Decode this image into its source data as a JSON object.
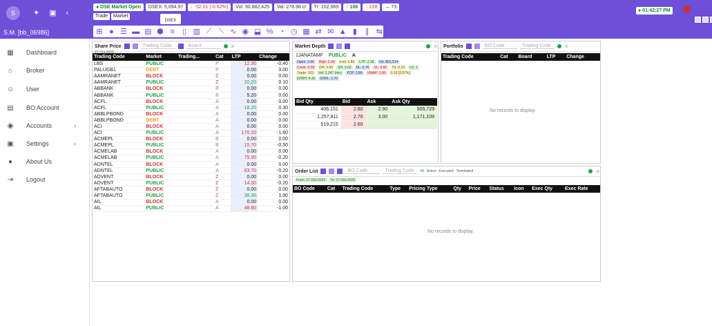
{
  "sidebar": {
    "avatar_letter": "S",
    "user_name": "S.M. [bb_06986]",
    "items": [
      {
        "label": "Dashboard",
        "icon": "dashboard-icon",
        "glyph": "▦",
        "arrow": ""
      },
      {
        "label": "Broker",
        "icon": "home-icon",
        "glyph": "⌂",
        "arrow": ""
      },
      {
        "label": "User",
        "icon": "user-icon",
        "glyph": "☺",
        "arrow": ""
      },
      {
        "label": "BO Account",
        "icon": "account-icon",
        "glyph": "▤",
        "arrow": ""
      },
      {
        "label": "Accounts",
        "icon": "accounts-icon",
        "glyph": "◉",
        "arrow": "›"
      },
      {
        "label": "Settings",
        "icon": "settings-icon",
        "glyph": "▣",
        "arrow": "›"
      },
      {
        "label": "About Us",
        "icon": "info-icon",
        "glyph": "●",
        "arrow": ""
      },
      {
        "label": "Logout",
        "icon": "logout-icon",
        "glyph": "⇥",
        "arrow": ""
      }
    ]
  },
  "ticker": {
    "market_status": "● DSE Market Open",
    "dsex": "DSEX: 5,094.97",
    "change": "↓ -32.01 (-0.62%)",
    "vol": "Vol: 90,882,425",
    "val": "Val: 278.98 cr",
    "trades": "Tr: 102,969",
    "up": "↑ 106",
    "down": "↓ 228",
    "unchanged": "↔ 73",
    "clock": "● 01:42:27 PM"
  },
  "tabs": {
    "trade": "Trade",
    "market": "Market",
    "dsex_label": "DSEX"
  },
  "share_price": {
    "title": "Share Price",
    "date": "27-Oct-2025",
    "trading_code_placeholder": "Trading Code",
    "board_placeholder": "Board",
    "columns": [
      "Trading Code",
      "Market",
      "Trading...",
      "Cat",
      "LTP",
      "Change"
    ],
    "rows": [
      [
        "LBS",
        "PUBLIC",
        "",
        "P",
        "12.30",
        "-0.40"
      ],
      [
        "PALUGB1",
        "DEBT",
        "",
        "P",
        "0.00",
        "0.00"
      ],
      [
        "AAMRANET",
        "BLOCK",
        "",
        "Z",
        "0.00",
        "0.00"
      ],
      [
        "AAMRANET",
        "PUBLIC",
        "",
        "Z",
        "20.20",
        "0.10"
      ],
      [
        "ABBANK",
        "BLOCK",
        "",
        "B",
        "0.00",
        "0.00"
      ],
      [
        "ABBANK",
        "PUBLIC",
        "",
        "B",
        "5.20",
        "0.00"
      ],
      [
        "ACFL",
        "BLOCK",
        "",
        "A",
        "0.00",
        "0.00"
      ],
      [
        "ACFL",
        "PUBLIC",
        "",
        "A",
        "18.20",
        "0.30"
      ],
      [
        "ABBLPBOND",
        "BLOCK",
        "",
        "A",
        "0.00",
        "0.00"
      ],
      [
        "ABBLPBOND",
        "DEBT",
        "",
        "A",
        "0.00",
        "0.00"
      ],
      [
        "ACI",
        "BLOCK",
        "",
        "A",
        "0.00",
        "0.00"
      ],
      [
        "ACI",
        "PUBLIC",
        "",
        "A",
        "170.20",
        "-1.60"
      ],
      [
        "ACMEPL",
        "BLOCK",
        "",
        "B",
        "0.00",
        "0.00"
      ],
      [
        "ACMEPL",
        "PUBLIC",
        "",
        "B",
        "15.70",
        "-0.50"
      ],
      [
        "ACMELAB",
        "BLOCK",
        "",
        "A",
        "0.00",
        "0.00"
      ],
      [
        "ACMELAB",
        "PUBLIC",
        "",
        "A",
        "75.30",
        "-0.20"
      ],
      [
        "ADNTEL",
        "BLOCK",
        "",
        "A",
        "0.00",
        "0.00"
      ],
      [
        "ADNTEL",
        "PUBLIC",
        "",
        "A",
        "63.70",
        "-0.20"
      ],
      [
        "ADVENT",
        "BLOCK",
        "",
        "Z",
        "0.00",
        "0.00"
      ],
      [
        "ADVENT",
        "PUBLIC",
        "",
        "Z",
        "14.30",
        "-0.20"
      ],
      [
        "AFTABAUTO",
        "BLOCK",
        "",
        "Z",
        "0.00",
        "0.00"
      ],
      [
        "AFTABAUTO",
        "PUBLIC",
        "",
        "Z",
        "36.30",
        "1.90"
      ],
      [
        "AIL",
        "BLOCK",
        "",
        "A",
        "0.00",
        "0.00"
      ],
      [
        "AIL",
        "PUBLIC",
        "",
        "A",
        "48.80",
        "-1.00"
      ]
    ]
  },
  "market_depth": {
    "title": "Market Depth",
    "symbol": "1JANATAMF",
    "market": "PUBLIC",
    "cat": "A",
    "stats_line1": [
      "Open: 2.90",
      "High: 2.90",
      "Low: 2.80",
      "LTP: 2.90",
      "Vol: 801,514"
    ],
    "stats_line2": [
      "Close: 0.00",
      "DH: 3.00",
      "SH: 3.00",
      "DL: 2.70",
      "SL: 2.60",
      "TS: 0.10",
      "LS: 1"
    ],
    "stats_line3": [
      "Trade: 103",
      "Val: 2.247 (mn)",
      "YCP: 2.80",
      "VWAP: 2.80",
      "0.10 [3.57%]"
    ],
    "stats_line4": [
      "52WH: 4.30",
      "52WL: 2.70"
    ],
    "columns": [
      "Bid Qty",
      "Bid",
      "Ask",
      "Ask Qty"
    ],
    "rows": [
      [
        "406,151",
        "2.80",
        "2.90",
        "905,729"
      ],
      [
        "1,257,811",
        "2.70",
        "3.00",
        "1,171,109"
      ],
      [
        "519,215",
        "2.60",
        "",
        ""
      ]
    ]
  },
  "portfolio": {
    "title": "Portfolio",
    "bo_placeholder": "BO Code",
    "tc_placeholder": "Trading Code",
    "columns": [
      "Trading Code",
      "Cat",
      "Board",
      "LTP",
      "Change"
    ],
    "empty": "No records to display."
  },
  "order_list": {
    "title": "Order List",
    "bo_placeholder": "BO Code",
    "tc_placeholder": "Trading Code",
    "filters": [
      "All",
      "Active",
      "Executed",
      "Terminated"
    ],
    "from": "From: 27-Oct-2025",
    "to": "To: 27-Oct-2025",
    "columns": [
      "BO Code",
      "Cat",
      "Trading Code",
      "Type",
      "Pricing Type",
      "Qty",
      "Price",
      "Status",
      "Icon",
      "Exec Qty",
      "Exec Rate"
    ],
    "empty": "No records to display."
  }
}
